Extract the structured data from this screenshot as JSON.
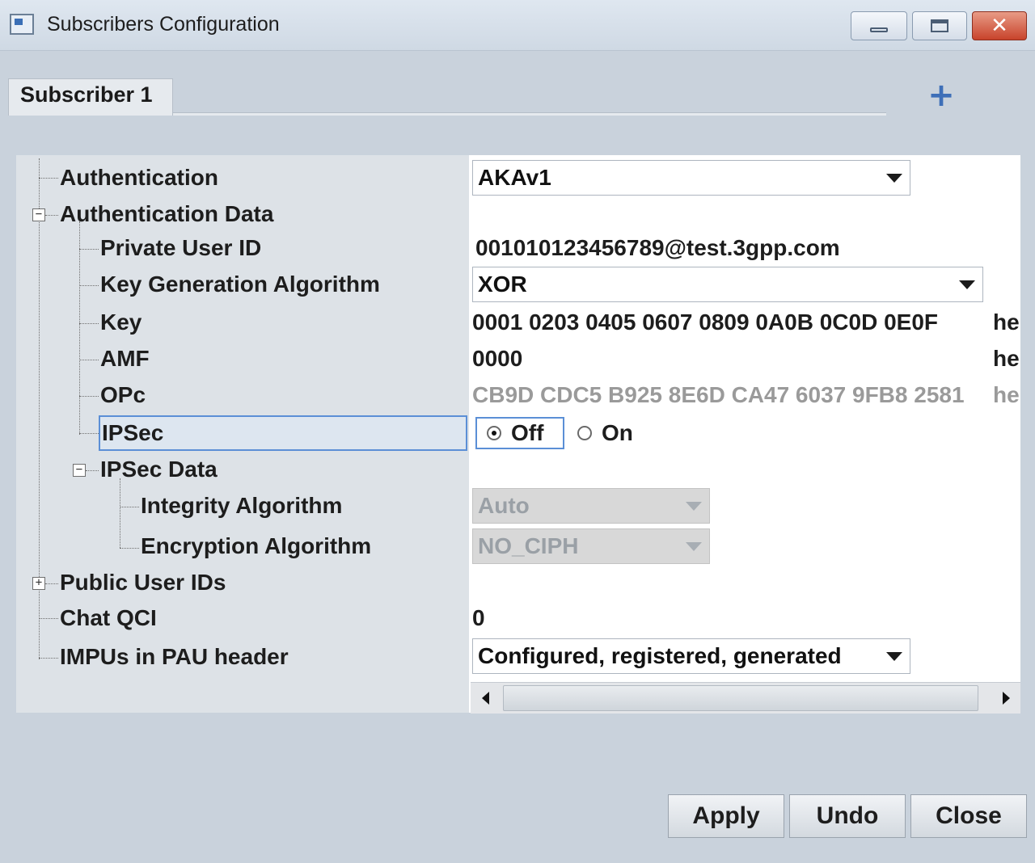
{
  "window": {
    "title": "Subscribers Configuration",
    "close_glyph": "✕"
  },
  "tabs": [
    {
      "label": "Subscriber 1"
    }
  ],
  "add_tab_glyph": "+",
  "tree": {
    "authentication": {
      "label": "Authentication",
      "value": "AKAv1"
    },
    "authentication_data": {
      "label": "Authentication Data",
      "expander": "−"
    },
    "private_user_id": {
      "label": "Private User ID",
      "value": "001010123456789@test.3gpp.com"
    },
    "key_generation_algorithm": {
      "label": "Key Generation Algorithm",
      "value": "XOR"
    },
    "key": {
      "label": "Key",
      "value": "0001 0203 0405 0607 0809 0A0B 0C0D 0E0F",
      "unit": "he"
    },
    "amf": {
      "label": "AMF",
      "value": "0000",
      "unit": "he"
    },
    "opc": {
      "label": "OPc",
      "value": "CB9D CDC5 B925 8E6D CA47 6037 9FB8 2581",
      "unit": "he"
    },
    "ipsec": {
      "label": "IPSec",
      "options": [
        "Off",
        "On"
      ],
      "selected": "Off"
    },
    "ipsec_data": {
      "label": "IPSec Data",
      "expander": "−"
    },
    "integrity_algorithm": {
      "label": "Integrity Algorithm",
      "value": "Auto"
    },
    "encryption_algorithm": {
      "label": "Encryption Algorithm",
      "value": "NO_CIPH"
    },
    "public_user_ids": {
      "label": "Public User IDs",
      "expander": "+"
    },
    "chat_qci": {
      "label": "Chat QCI",
      "value": "0"
    },
    "impus_in_pau_header": {
      "label": "IMPUs in PAU header",
      "value": "Configured, registered, generated"
    }
  },
  "buttons": {
    "apply": "Apply",
    "undo": "Undo",
    "close": "Close"
  },
  "colors": {
    "accent": "#3e6fb8",
    "selection_border": "#5b8fd6",
    "disabled_text": "#9aa0a6"
  }
}
